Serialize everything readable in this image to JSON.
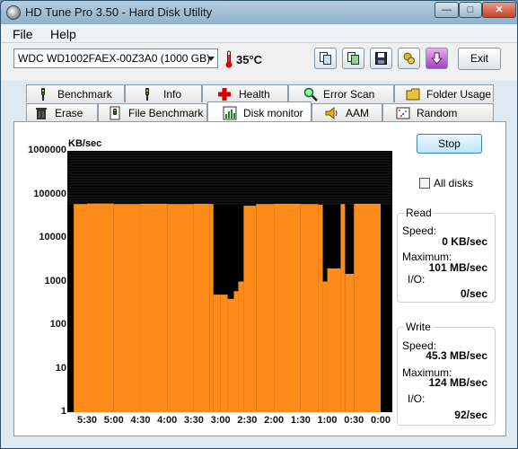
{
  "window": {
    "title": "HD Tune Pro 3.50 - Hard Disk Utility"
  },
  "menu": [
    {
      "label": "File"
    },
    {
      "label": "Help"
    }
  ],
  "toolbar": {
    "drive": "WDC WD1002FAEX-00Z3A0 (1000 GB)",
    "temperature": "35°C",
    "exit_label": "Exit"
  },
  "tabs_row1": [
    {
      "label": "Benchmark",
      "icon": "benchmark-icon"
    },
    {
      "label": "Info",
      "icon": "info-icon"
    },
    {
      "label": "Health",
      "icon": "health-icon"
    },
    {
      "label": "Error Scan",
      "icon": "error-scan-icon"
    },
    {
      "label": "Folder Usage",
      "icon": "folder-icon"
    }
  ],
  "tabs_row2": [
    {
      "label": "Erase",
      "icon": "erase-icon"
    },
    {
      "label": "File Benchmark",
      "icon": "file-benchmark-icon"
    },
    {
      "label": "Disk monitor",
      "icon": "disk-monitor-icon",
      "active": true
    },
    {
      "label": "AAM",
      "icon": "speaker-icon"
    },
    {
      "label": "Random Access",
      "icon": "random-access-icon"
    }
  ],
  "monitor": {
    "stop_label": "Stop",
    "all_disks_label": "All disks",
    "read": {
      "title": "Read",
      "speed_label": "Speed:",
      "speed": "0 KB/sec",
      "max_label": "Maximum:",
      "max": "101 MB/sec",
      "io_label": "I/O:",
      "io": "0/sec"
    },
    "write": {
      "title": "Write",
      "speed_label": "Speed:",
      "speed": "45.3 MB/sec",
      "max_label": "Maximum:",
      "max": "124 MB/sec",
      "io_label": "I/O:",
      "io": "92/sec"
    }
  },
  "chart_data": {
    "type": "area",
    "yunit": "KB/sec",
    "y_scale": "log",
    "ylim": [
      1,
      1000000
    ],
    "yticks": [
      "1000000",
      "100000",
      "10000",
      "1000",
      "100",
      "10",
      "1"
    ],
    "xticks": [
      "5:30",
      "5:00",
      "4:30",
      "4:00",
      "3:30",
      "3:00",
      "2:30",
      "2:00",
      "1:30",
      "1:00",
      "0:30",
      "0:00"
    ],
    "colors": {
      "background": "#000000",
      "write": "#ff8c1a",
      "read_grid": "#444444"
    },
    "series": [
      {
        "name": "Write",
        "x": [
          "5:45",
          "5:30",
          "5:00",
          "4:30",
          "4:00",
          "3:30",
          "3:12",
          "3:08",
          "3:00",
          "2:52",
          "2:45",
          "2:40",
          "2:34",
          "2:20",
          "2:00",
          "1:30",
          "1:10",
          "1:05",
          "1:00",
          "0:45",
          "0:40",
          "0:30",
          "0:00"
        ],
        "values": [
          60000,
          62000,
          60000,
          61000,
          60000,
          61000,
          60000,
          500,
          500,
          400,
          600,
          1000,
          55000,
          60000,
          61000,
          60000,
          58000,
          1000,
          2000,
          60000,
          1500,
          61000,
          62000
        ]
      }
    ]
  }
}
